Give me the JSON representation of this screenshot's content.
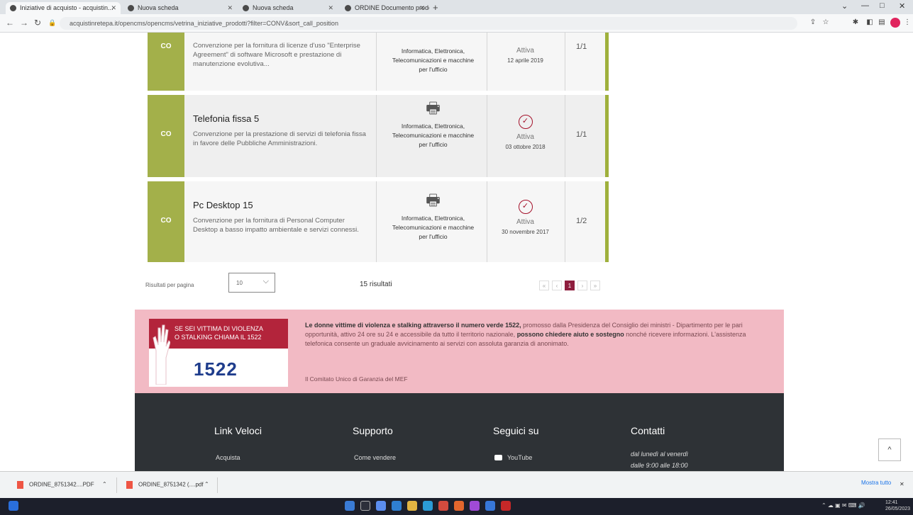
{
  "browser": {
    "tabs": [
      {
        "title": "Iniziative di acquisto - acquistin..."
      },
      {
        "title": "Nuova scheda"
      },
      {
        "title": "Nuova scheda"
      },
      {
        "title": "ORDINE Documento prodotti..."
      }
    ],
    "url": "acquistinretepa.it/opencms/opencms/vetrina_iniziative_prodotti?filter=CONV&sort_call_position",
    "new_tab_symbol": "+"
  },
  "rows": [
    {
      "badge": "CO",
      "title": "",
      "description": "Convenzione per la fornitura di licenze d'uso \"Enterprise Agreement\" di software Microsoft e prestazione di manutenzione evolutiva...",
      "category": "Informatica, Elettronica, Telecomunicazioni e macchine per l'ufficio",
      "status": "Attiva",
      "date": "12 aprile 2019",
      "lot": "1/1"
    },
    {
      "badge": "CO",
      "title": "Telefonia fissa 5",
      "description": "Convenzione per la prestazione di servizi di telefonia fissa in favore delle Pubbliche Amministrazioni.",
      "category": "Informatica, Elettronica, Telecomunicazioni e macchine per l'ufficio",
      "status": "Attiva",
      "date": "03 ottobre 2018",
      "lot": "1/1"
    },
    {
      "badge": "CO",
      "title": "Pc Desktop 15",
      "description": "Convenzione per la fornitura di Personal Computer Desktop a basso impatto ambientale e servizi connessi.",
      "category": "Informatica, Elettronica, Telecomunicazioni e macchine per l'ufficio",
      "status": "Attiva",
      "date": "30 novembre 2017",
      "lot": "1/2"
    }
  ],
  "pagination": {
    "per_page_label": "Risultati per pagina",
    "per_page_value": "10",
    "results": "15 risultati",
    "pages": [
      "«",
      "‹",
      "1",
      "›",
      "»"
    ],
    "current_page": "1"
  },
  "banner": {
    "line1": "SE SEI VITTIMA DI VIOLENZA",
    "line2": "O STALKING CHIAMA IL 1522",
    "number": "1522",
    "text_bold": "Le donne vittime di violenza e stalking attraverso il numero verde 1522,",
    "text_1": " promosso dalla Presidenza del Consiglio dei ministri - Dipartimento per le pari opportunità, attivo 24 ore su 24 e accessibile da tutto il territorio nazionale, ",
    "text_bold2": "possono chiedere aiuto e sostegno",
    "text_2": " nonché ricevere informazioni. L'assistenza telefonica consente un graduale avvicinamento ai servizi con assoluta garanzia di anonimato.",
    "signature": "Il Comitato Unico di Garanzia del MEF"
  },
  "footer": {
    "col1_title": "Link Veloci",
    "col1_link": "Acquista",
    "col2_title": "Supporto",
    "col2_link": "Come vendere",
    "col3_title": "Seguici su",
    "col3_link": "YouTube",
    "col4_title": "Contatti",
    "hours_line1": "dal lunedì al venerdì",
    "hours_line2": "dalle 9:00 alle 18:00"
  },
  "scroll_top_symbol": "^",
  "downloads": [
    {
      "name": "ORDINE_8751342....PDF"
    },
    {
      "name": "ORDINE_8751342 (....pdf"
    }
  ],
  "show_all": "Mostra tutto",
  "taskbar": {
    "time": "12:41",
    "date": "26/05/2023"
  },
  "colors": {
    "badge": "#a3b04a",
    "accent": "#9fb03c",
    "status_icon": "#a4112a",
    "banner_bg": "#f2bac4",
    "banner_red": "#b3243b",
    "footer_bg": "#2e3236",
    "page_current": "#8e1d3d"
  }
}
